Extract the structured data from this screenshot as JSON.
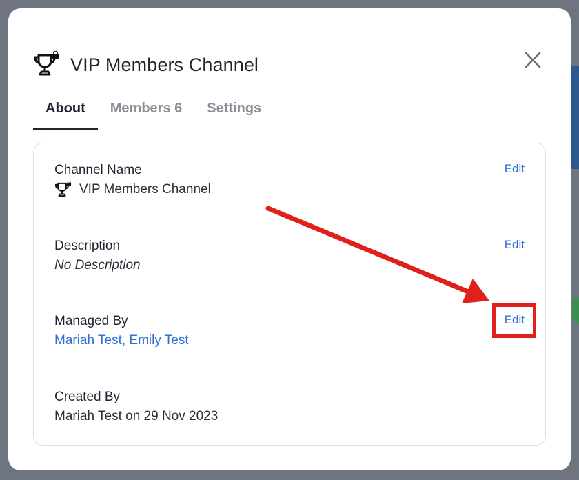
{
  "modal": {
    "title": "VIP Members Channel",
    "close_icon": "close-icon",
    "title_icon": "trophy-lock-icon"
  },
  "tabs": [
    {
      "label": "About",
      "active": true
    },
    {
      "label": "Members 6",
      "active": false
    },
    {
      "label": "Settings",
      "active": false
    }
  ],
  "sections": {
    "channel_name": {
      "label": "Channel Name",
      "value": "VIP Members Channel",
      "edit_label": "Edit",
      "icon": "trophy-lock-icon"
    },
    "description": {
      "label": "Description",
      "value": "No Description",
      "edit_label": "Edit"
    },
    "managed_by": {
      "label": "Managed By",
      "value": "Mariah Test, Emily Test",
      "edit_label": "Edit"
    },
    "created_by": {
      "label": "Created By",
      "value": "Mariah Test on 29 Nov 2023"
    }
  },
  "annotation": {
    "highlight_color": "#e0201b",
    "link_color": "#2d6fd6"
  }
}
